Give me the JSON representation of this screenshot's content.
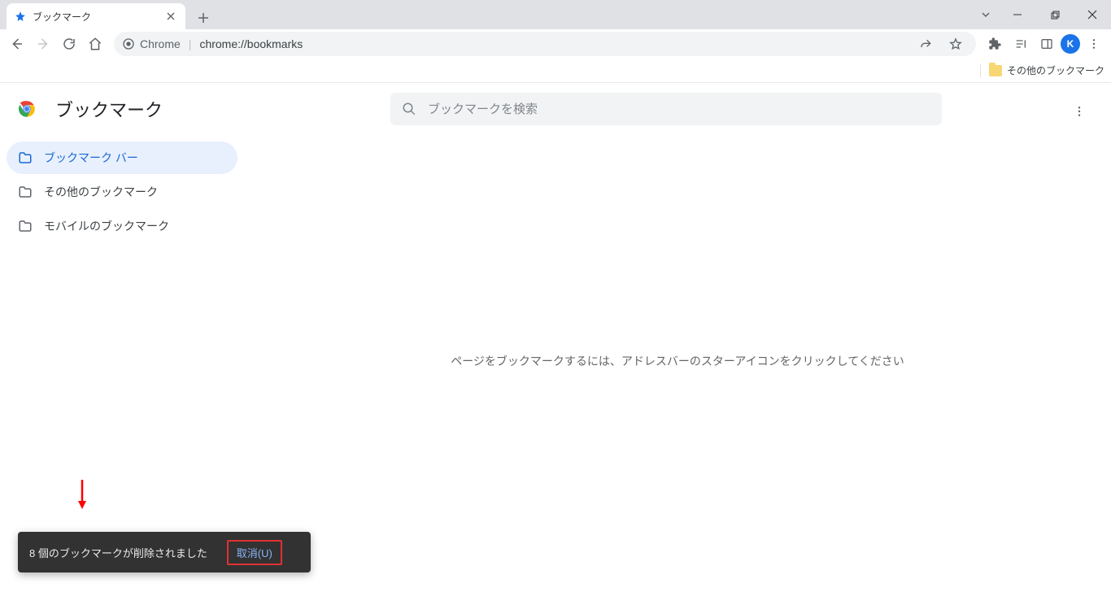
{
  "browser": {
    "tab_title": "ブックマーク",
    "origin_label": "Chrome",
    "url": "chrome://bookmarks",
    "profile_initial": "K",
    "other_bookmarks_chip": "その他のブックマーク"
  },
  "page": {
    "title": "ブックマーク",
    "search_placeholder": "ブックマークを検索",
    "empty_hint": "ページをブックマークするには、アドレスバーのスターアイコンをクリックしてください"
  },
  "sidebar": {
    "items": [
      {
        "label": "ブックマーク バー",
        "active": true
      },
      {
        "label": "その他のブックマーク",
        "active": false
      },
      {
        "label": "モバイルのブックマーク",
        "active": false
      }
    ]
  },
  "toast": {
    "message": "8 個のブックマークが削除されました",
    "undo_label": "取消(U)"
  },
  "colors": {
    "accent": "#1a73e8",
    "toast_bg": "#323232",
    "highlight_border": "#e03131"
  }
}
